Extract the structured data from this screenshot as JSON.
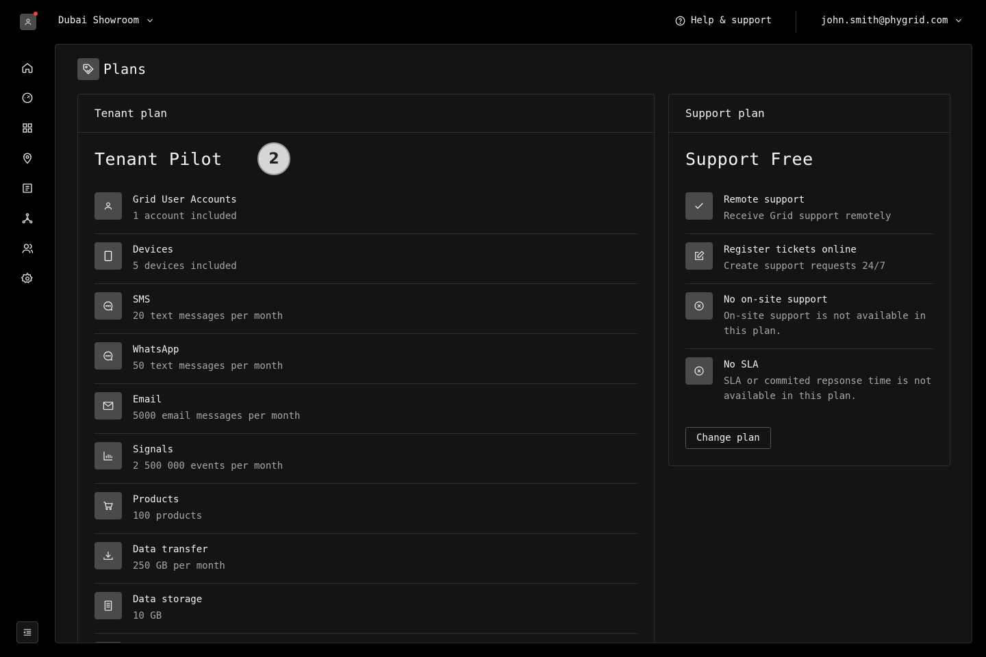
{
  "topbar": {
    "workspace": "Dubai Showroom",
    "help": "Help & support",
    "user_email": "john.smith@phygrid.com"
  },
  "sidebar": {
    "items": [
      "home-icon",
      "dashboard-icon",
      "apps-icon",
      "location-icon",
      "list-icon",
      "network-icon",
      "users-icon",
      "settings-icon"
    ]
  },
  "page": {
    "title": "Plans"
  },
  "tenant": {
    "header": "Tenant plan",
    "plan_name": "Tenant Pilot",
    "badge": "2",
    "features": [
      {
        "icon": "user-icon",
        "title": "Grid User Accounts",
        "desc": "1 account included"
      },
      {
        "icon": "device-icon",
        "title": "Devices",
        "desc": "5 devices included"
      },
      {
        "icon": "chat-icon",
        "title": "SMS",
        "desc": "20 text messages per month"
      },
      {
        "icon": "chat-icon",
        "title": "WhatsApp",
        "desc": "50 text messages per month"
      },
      {
        "icon": "mail-icon",
        "title": "Email",
        "desc": "5000 email messages per month"
      },
      {
        "icon": "chart-icon",
        "title": "Signals",
        "desc": "2 500 000 events per month"
      },
      {
        "icon": "cart-icon",
        "title": "Products",
        "desc": "100 products"
      },
      {
        "icon": "download-icon",
        "title": "Data transfer",
        "desc": "250 GB per month"
      },
      {
        "icon": "storage-icon",
        "title": "Data storage",
        "desc": "10 GB"
      }
    ]
  },
  "support": {
    "header": "Support plan",
    "plan_name": "Support Free",
    "features": [
      {
        "icon": "check-icon",
        "title": "Remote support",
        "desc": "Receive Grid support remotely"
      },
      {
        "icon": "edit-icon",
        "title": "Register tickets online",
        "desc": "Create support requests 24/7"
      },
      {
        "icon": "x-circle-icon",
        "title": "No on-site support",
        "desc": "On-site support is not available in this plan."
      },
      {
        "icon": "x-circle-icon",
        "title": "No SLA",
        "desc": "SLA or commited repsonse time is not available in this plan."
      }
    ],
    "change_button": "Change plan"
  }
}
